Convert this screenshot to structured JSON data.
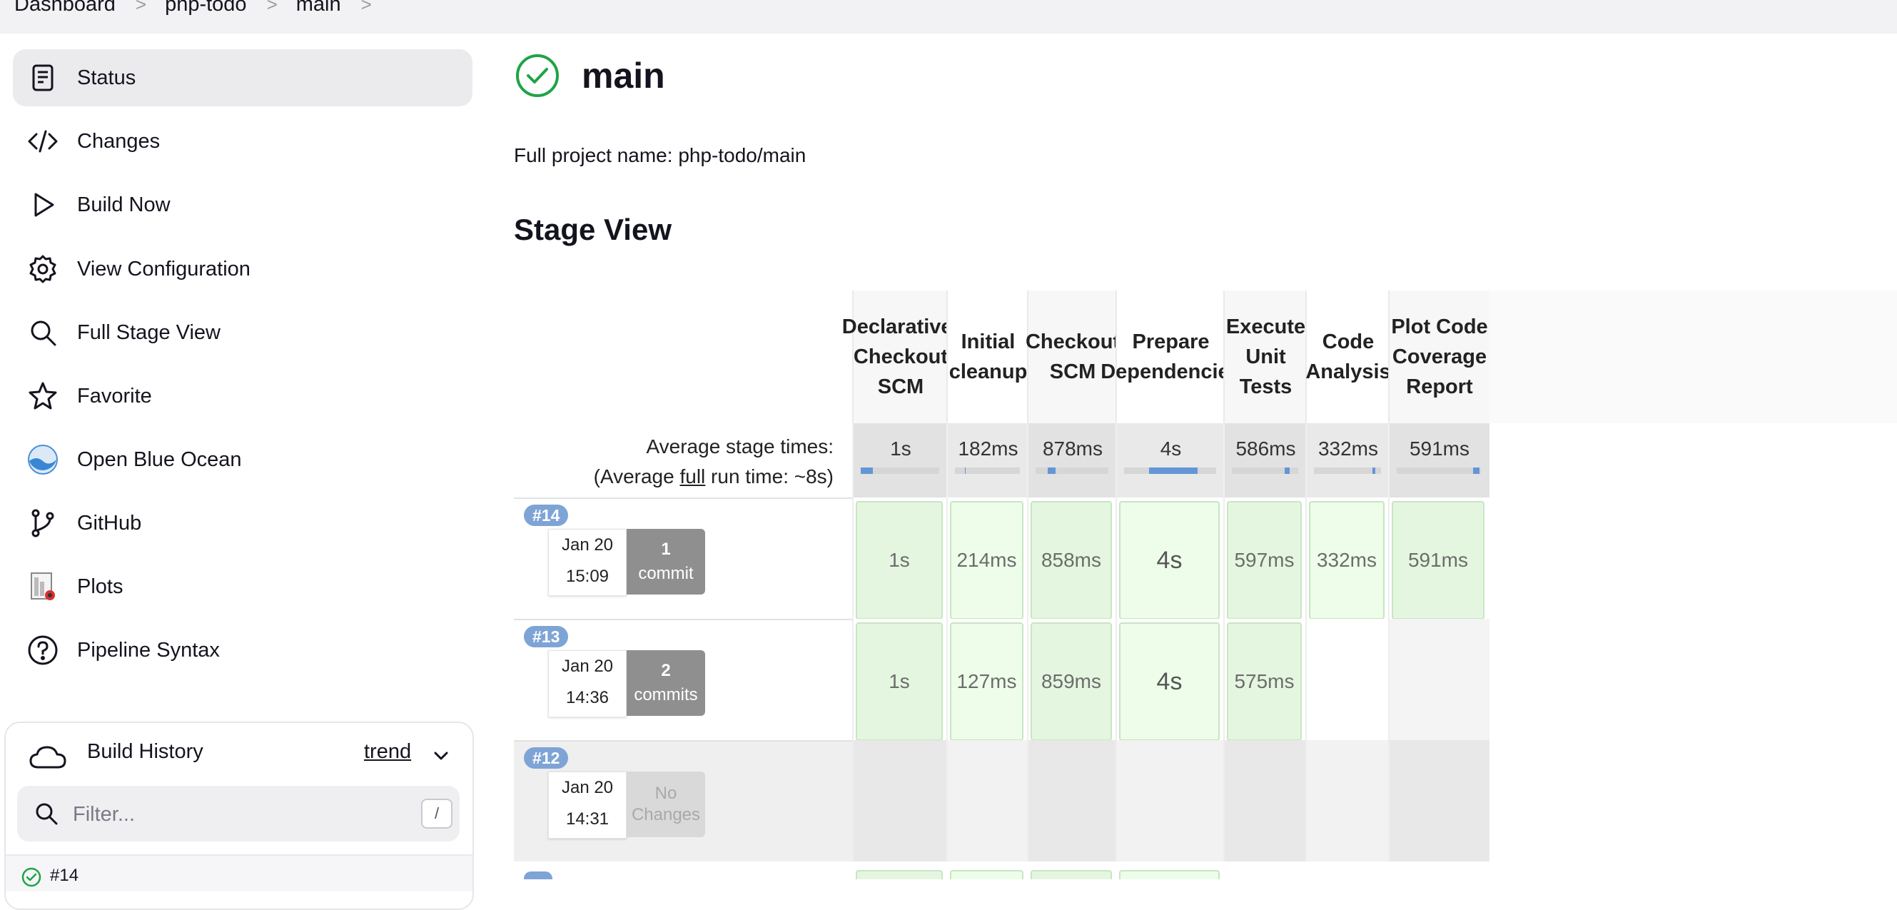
{
  "breadcrumb": [
    "Dashboard",
    "php-todo",
    "main"
  ],
  "sidebar": {
    "items": [
      {
        "label": "Status",
        "icon": "document-icon",
        "active": true
      },
      {
        "label": "Changes",
        "icon": "code-icon"
      },
      {
        "label": "Build Now",
        "icon": "play-icon"
      },
      {
        "label": "View Configuration",
        "icon": "gear-icon"
      },
      {
        "label": "Full Stage View",
        "icon": "search-icon"
      },
      {
        "label": "Favorite",
        "icon": "star-icon"
      },
      {
        "label": "Open Blue Ocean",
        "icon": "blue-ocean-icon"
      },
      {
        "label": "GitHub",
        "icon": "branch-icon"
      },
      {
        "label": "Plots",
        "icon": "plots-icon"
      },
      {
        "label": "Pipeline Syntax",
        "icon": "help-icon"
      }
    ]
  },
  "build_history": {
    "title": "Build History",
    "trend_label": "trend",
    "filter_placeholder": "Filter...",
    "shortcut": "/",
    "first_build": "#14"
  },
  "main": {
    "title": "main",
    "full_name": "Full project name: php-todo/main",
    "stage_view_heading": "Stage View"
  },
  "stage_view": {
    "avg_label_line1": "Average stage times:",
    "avg_label_prefix": "(Average ",
    "avg_label_full": "full",
    "avg_label_suffix": " run time: ~8s)",
    "stages": [
      {
        "name": "Declarative: Checkout SCM",
        "avg": "1s",
        "bar_start": 0.0,
        "bar_end": 0.15
      },
      {
        "name": "Initial cleanup",
        "avg": "182ms",
        "bar_start": 0.15,
        "bar_end": 0.17
      },
      {
        "name": "Checkout SCM",
        "avg": "878ms",
        "bar_start": 0.17,
        "bar_end": 0.27
      },
      {
        "name": "Prepare Dependencies",
        "avg": "4s",
        "bar_start": 0.27,
        "bar_end": 0.8
      },
      {
        "name": "Execute Unit Tests",
        "avg": "586ms",
        "bar_start": 0.8,
        "bar_end": 0.87
      },
      {
        "name": "Code Analysis",
        "avg": "332ms",
        "bar_start": 0.87,
        "bar_end": 0.91
      },
      {
        "name": "Plot Code Coverage Report",
        "avg": "591ms",
        "bar_start": 0.91,
        "bar_end": 0.98
      }
    ],
    "builds": [
      {
        "id": "#14",
        "date": "Jan 20",
        "time": "15:09",
        "changes_count": "1",
        "changes_label": "commit",
        "cells": [
          "1s",
          "214ms",
          "858ms",
          "4s",
          "597ms",
          "332ms",
          "591ms"
        ]
      },
      {
        "id": "#13",
        "date": "Jan 20",
        "time": "14:36",
        "changes_count": "2",
        "changes_label": "commits",
        "cells": [
          "1s",
          "127ms",
          "859ms",
          "4s",
          "575ms",
          "",
          ""
        ]
      },
      {
        "id": "#12",
        "date": "Jan 20",
        "time": "14:31",
        "changes_count": "",
        "changes_label": "No Changes",
        "cells": [
          "",
          "",
          "",
          "",
          "",
          "",
          ""
        ]
      }
    ],
    "colors": {
      "success_a": "#e4f6e0",
      "success_b": "#edfde9",
      "empty_a": "#e8e8e8",
      "empty_b": "#f2f2f2",
      "bar_fill": "#6495d6",
      "badge": "#7ea4d6"
    }
  }
}
